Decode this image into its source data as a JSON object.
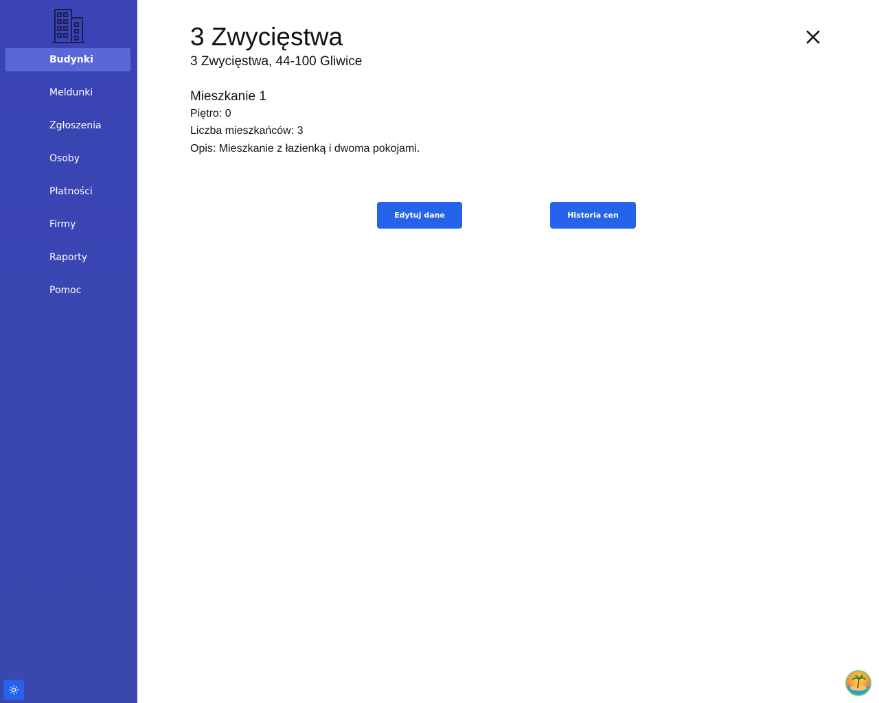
{
  "sidebar": {
    "logo_icon": "building-icon",
    "items": [
      {
        "label": "Budynki",
        "active": true
      },
      {
        "label": "Meldunki",
        "active": false
      },
      {
        "label": "Zgłoszenia",
        "active": false
      },
      {
        "label": "Osoby",
        "active": false
      },
      {
        "label": "Płatności",
        "active": false
      },
      {
        "label": "Firmy",
        "active": false
      },
      {
        "label": "Raporty",
        "active": false
      },
      {
        "label": "Pomoc",
        "active": false
      }
    ],
    "theme_toggle_icon": "sun-icon"
  },
  "building": {
    "title": "3 Zwycięstwa",
    "address": "3 Zwycięstwa, 44-100 Gliwice"
  },
  "apartment": {
    "title": "Mieszkanie 1",
    "floor": "Piętro: 0",
    "residents": "Liczba mieszkańców: 3",
    "description": "Opis: Mieszkanie z łazienką i dwoma pokojami."
  },
  "actions": {
    "edit_label": "Edytuj dane",
    "history_label": "Historia cen"
  },
  "colors": {
    "sidebar_bg": "#3a44b6",
    "sidebar_active": "#5a67d8",
    "accent": "#2563eb"
  }
}
